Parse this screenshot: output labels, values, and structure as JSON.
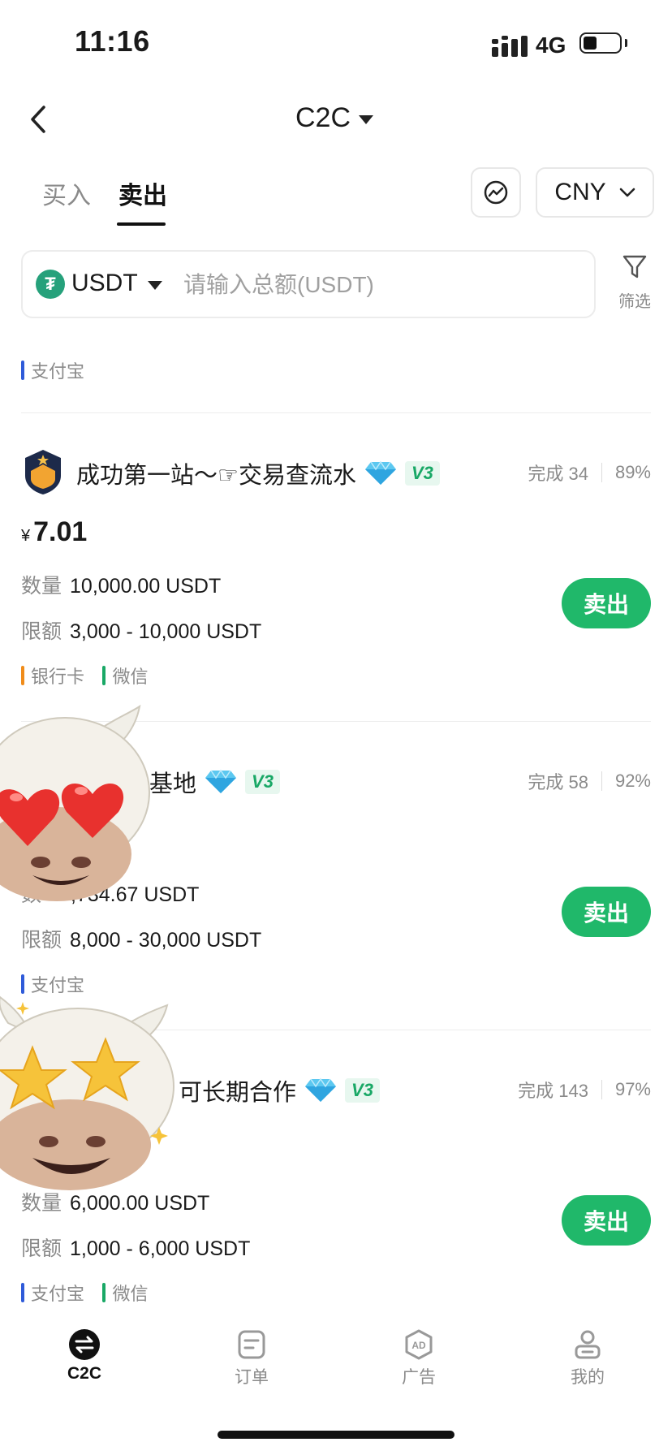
{
  "status_bar": {
    "time": "11:16",
    "network": "4G"
  },
  "nav": {
    "title": "C2C"
  },
  "tabs": [
    {
      "label": "买入",
      "active": false
    },
    {
      "label": "卖出",
      "active": true
    }
  ],
  "currency": {
    "selected": "CNY"
  },
  "search": {
    "coin": "USDT",
    "placeholder": "请输入总额(USDT)",
    "filter_label": "筛选"
  },
  "colors": {
    "accent": "#20b86a",
    "alipay": "#2f5bd9",
    "bank_card": "#f08c1a",
    "wechat": "#19a866"
  },
  "top_partial_card": {
    "payment_methods": [
      "支付宝"
    ]
  },
  "listings": [
    {
      "merchant": "成功第一站～☞交易查流水",
      "level": "V3",
      "completed": "完成 34",
      "rate": "89%",
      "currency_symbol": "¥",
      "price": "7.01",
      "quantity_label": "数量",
      "quantity": "10,000.00 USDT",
      "limit_label": "限额",
      "limit": "3,000 - 10,000 USDT",
      "action": "卖出",
      "payment_methods": [
        "银行卡",
        "微信"
      ]
    },
    {
      "merchant": "基地",
      "level": "V3",
      "completed": "完成 58",
      "rate": "92%",
      "quantity_label": "数",
      "quantity": ",734.67 USDT",
      "limit_label": "限额",
      "limit": "8,000 - 30,000 USDT",
      "action": "卖出",
      "payment_methods": [
        "支付宝"
      ]
    },
    {
      "merchant": "可长期合作",
      "level": "V3",
      "completed": "完成 143",
      "rate": "97%",
      "quantity_label": "数量",
      "quantity": "6,000.00 USDT",
      "limit_label": "限额",
      "limit": "1,000 - 6,000 USDT",
      "action": "卖出",
      "payment_methods": [
        "支付宝",
        "微信"
      ]
    }
  ],
  "bottom_nav": [
    {
      "label": "C2C",
      "icon": "swap-icon",
      "active": true
    },
    {
      "label": "订单",
      "icon": "order-icon",
      "active": false
    },
    {
      "label": "广告",
      "icon": "ad-icon",
      "active": false
    },
    {
      "label": "我的",
      "icon": "profile-icon",
      "active": false
    }
  ],
  "stickers": [
    "cow-heart-eyes-sticker",
    "cow-star-eyes-sticker"
  ]
}
